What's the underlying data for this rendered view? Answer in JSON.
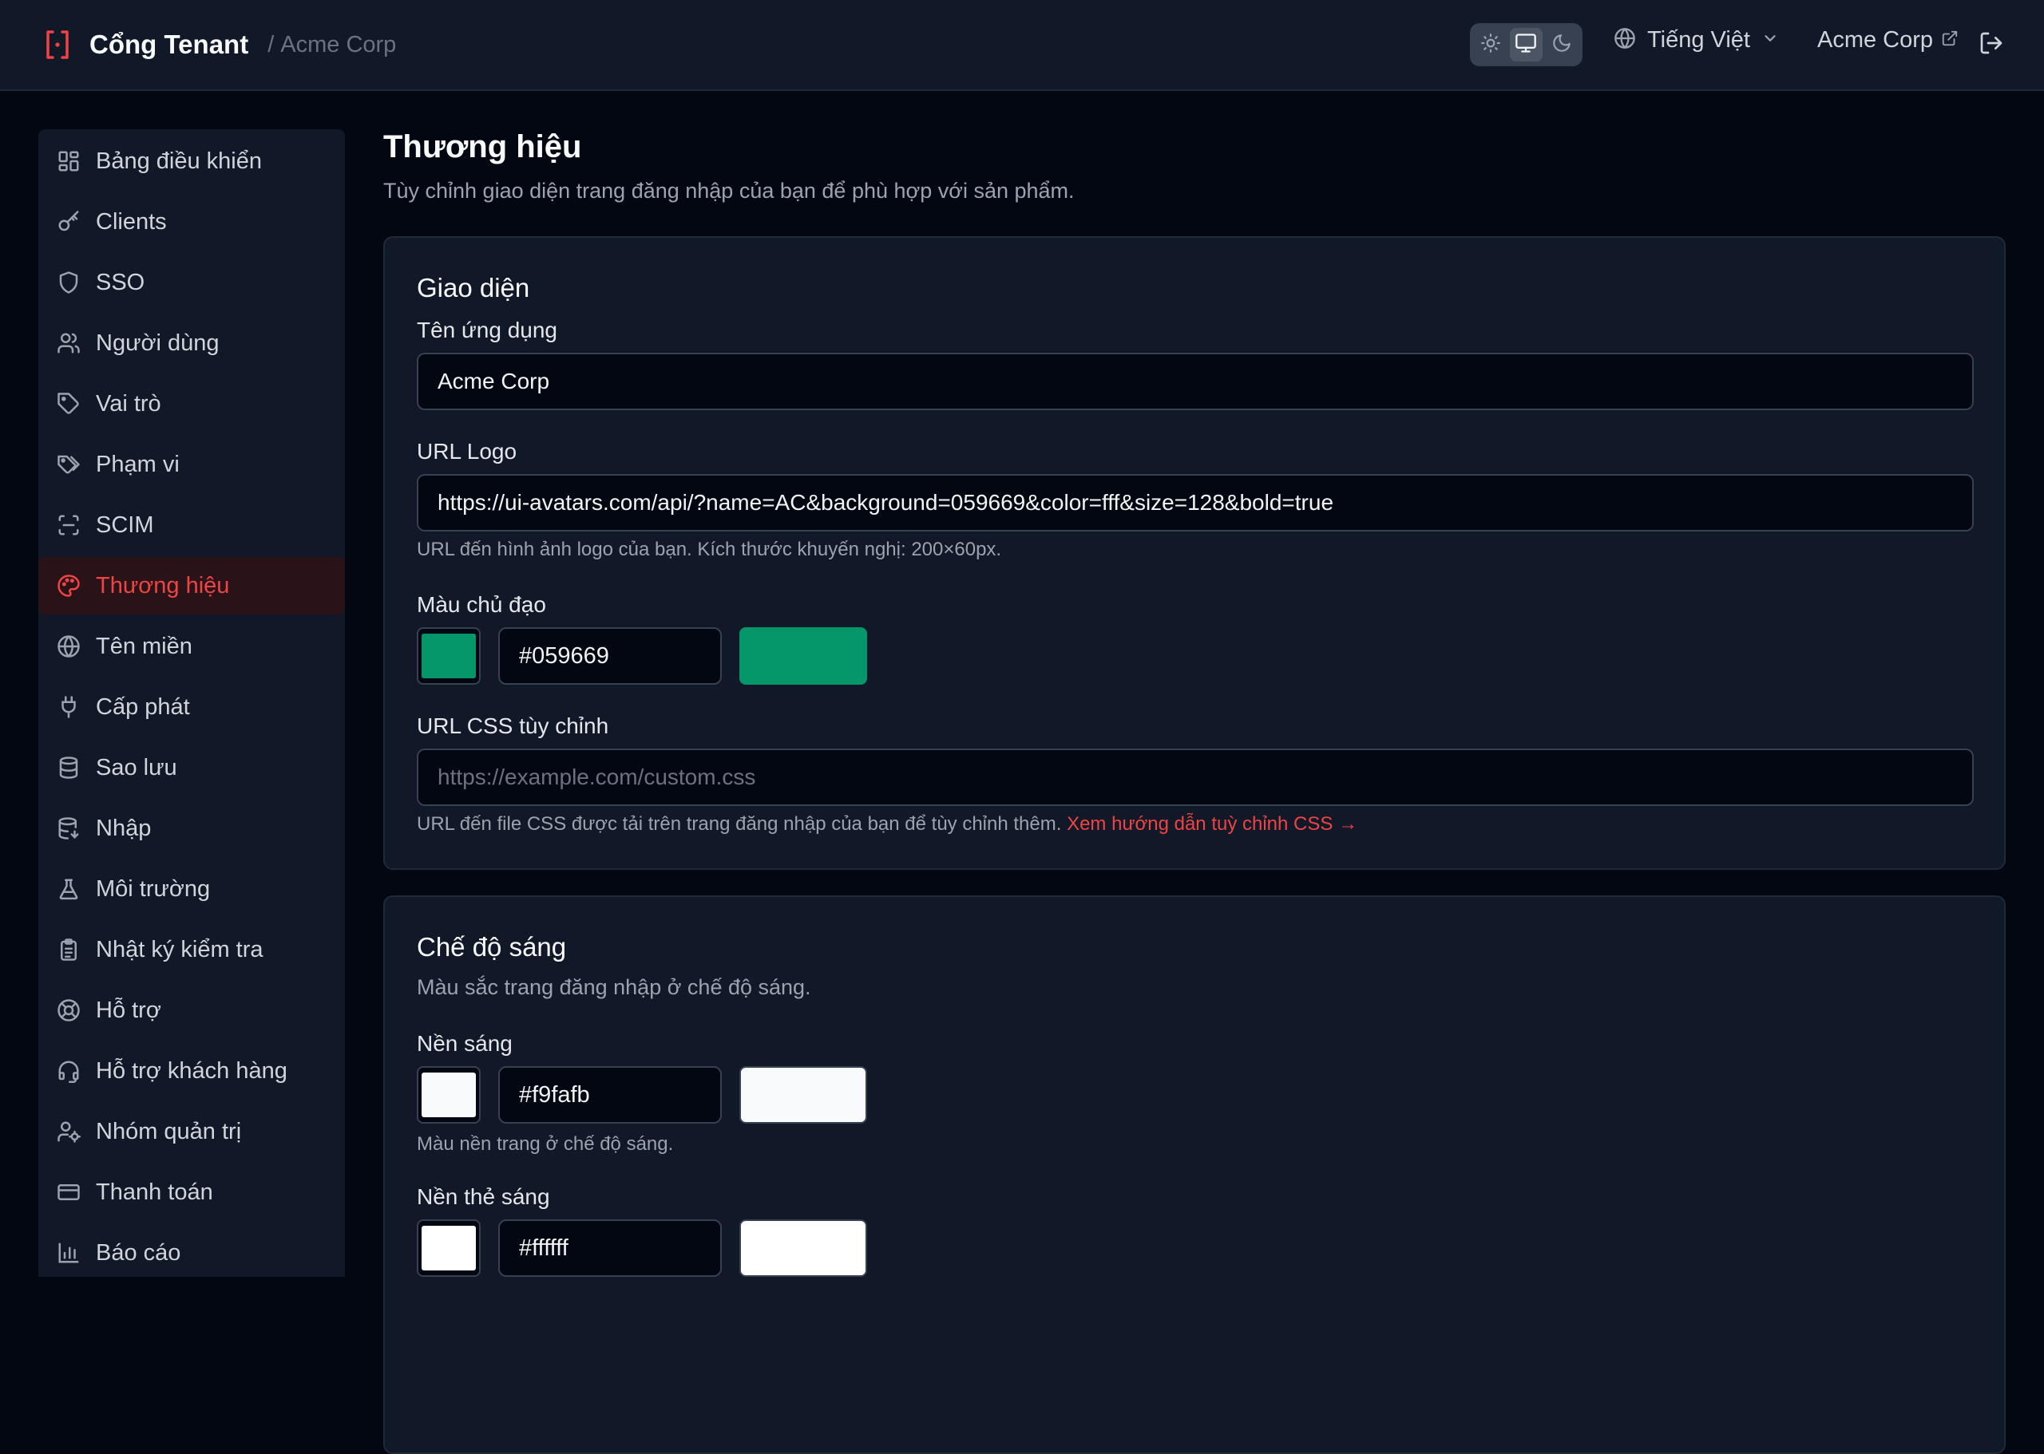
{
  "header": {
    "app_title": "Cổng Tenant",
    "separator": "/",
    "tenant_name": "Acme Corp",
    "theme_modes": [
      "light",
      "system",
      "dark"
    ],
    "active_theme": "system",
    "language": "Tiếng Việt",
    "tenant_link": "Acme Corp",
    "icons": [
      "brand-bracket-icon",
      "sun-icon",
      "monitor-icon",
      "moon-icon",
      "globe-icon",
      "chevron-down-icon",
      "external-link-icon",
      "logout-icon"
    ],
    "accent_color": "#ef4444"
  },
  "sidebar": {
    "items": [
      {
        "label": "Bảng điều khiển",
        "icon": "dashboard-icon"
      },
      {
        "label": "Clients",
        "icon": "key-icon"
      },
      {
        "label": "SSO",
        "icon": "shield-icon"
      },
      {
        "label": "Người dùng",
        "icon": "users-icon"
      },
      {
        "label": "Vai trò",
        "icon": "tag-icon"
      },
      {
        "label": "Phạm vi",
        "icon": "tags-icon"
      },
      {
        "label": "SCIM",
        "icon": "scan-icon"
      },
      {
        "label": "Thương hiệu",
        "icon": "palette-icon",
        "active": true
      },
      {
        "label": "Tên miền",
        "icon": "globe-icon"
      },
      {
        "label": "Cấp phát",
        "icon": "plug-icon"
      },
      {
        "label": "Sao lưu",
        "icon": "database-icon"
      },
      {
        "label": "Nhập",
        "icon": "database-import-icon"
      },
      {
        "label": "Môi trường",
        "icon": "flask-icon"
      },
      {
        "label": "Nhật ký kiểm tra",
        "icon": "clipboard-icon"
      },
      {
        "label": "Hỗ trợ",
        "icon": "lifebuoy-icon"
      },
      {
        "label": "Hỗ trợ khách hàng",
        "icon": "headset-icon"
      },
      {
        "label": "Nhóm quản trị",
        "icon": "user-cog-icon"
      },
      {
        "label": "Thanh toán",
        "icon": "credit-card-icon"
      },
      {
        "label": "Báo cáo",
        "icon": "bar-chart-icon"
      }
    ]
  },
  "main": {
    "title": "Thương hiệu",
    "subtitle": "Tùy chỉnh giao diện trang đăng nhập của bạn để phù hợp với sản phẩm.",
    "appearance": {
      "title": "Giao diện",
      "app_name_label": "Tên ứng dụng",
      "app_name_value": "Acme Corp",
      "logo_url_label": "URL Logo",
      "logo_url_value": "https://ui-avatars.com/api/?name=AC&background=059669&color=fff&size=128&bold=true",
      "logo_url_help": "URL đến hình ảnh logo của bạn. Kích thước khuyến nghị: 200×60px.",
      "primary_color_label": "Màu chủ đạo",
      "primary_color_value": "#059669",
      "custom_css_label": "URL CSS tùy chỉnh",
      "custom_css_placeholder": "https://example.com/custom.css",
      "custom_css_help": "URL đến file CSS được tải trên trang đăng nhập của bạn để tùy chỉnh thêm.",
      "custom_css_link": "Xem hướng dẫn tuỳ chỉnh CSS →"
    },
    "light_mode": {
      "title": "Chế độ sáng",
      "subtitle": "Màu sắc trang đăng nhập ở chế độ sáng.",
      "background_label": "Nền sáng",
      "background_value": "#f9fafb",
      "background_help": "Màu nền trang ở chế độ sáng.",
      "card_background_label": "Nền thẻ sáng",
      "card_background_value": "#ffffff"
    }
  }
}
